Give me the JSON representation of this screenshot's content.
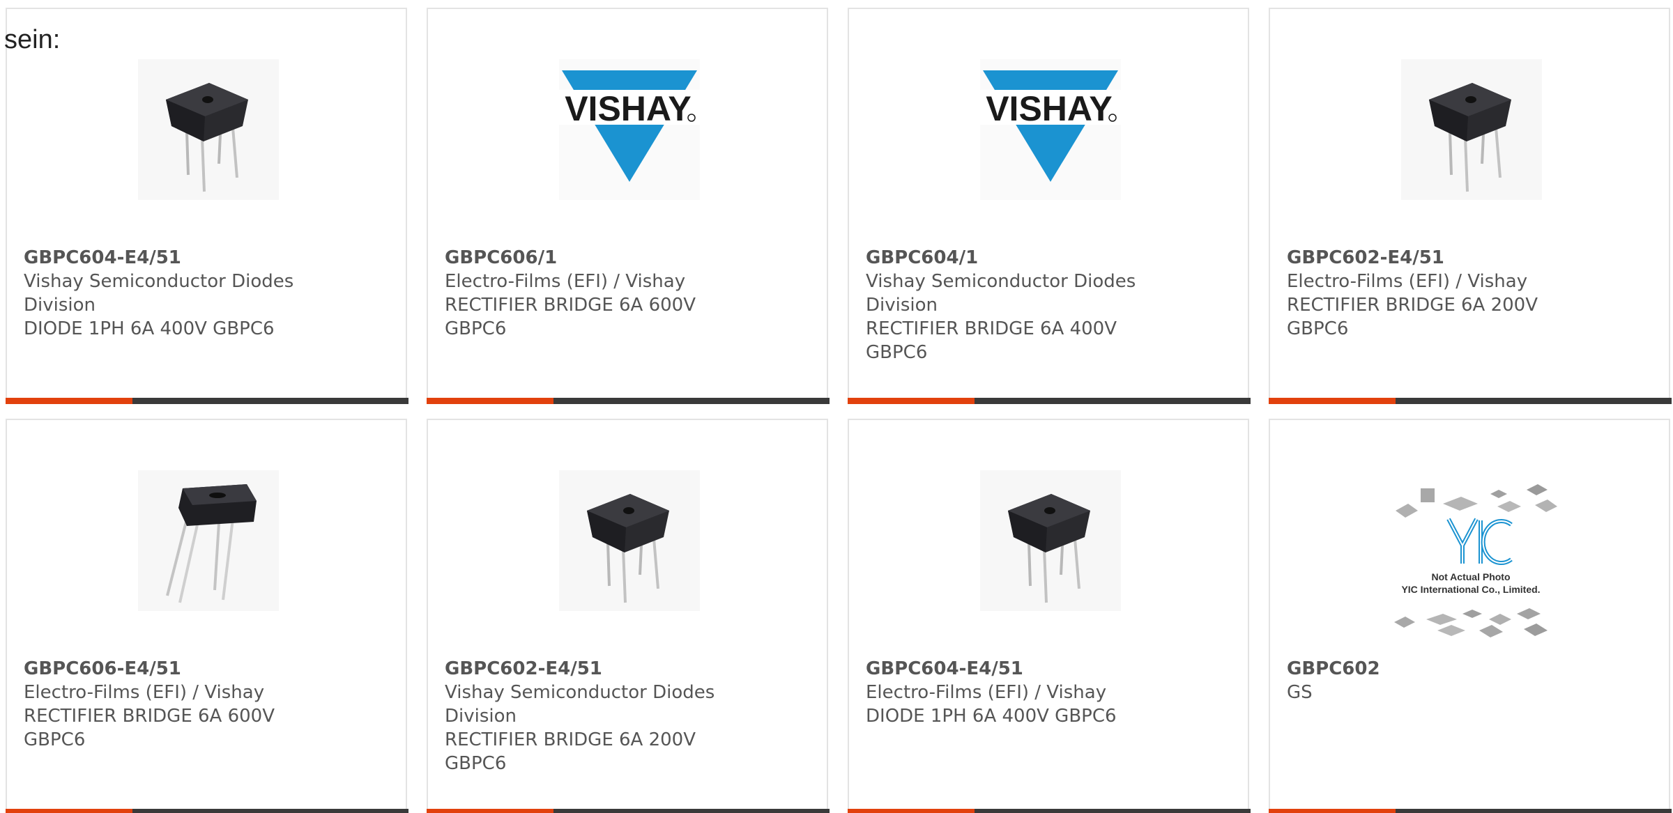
{
  "intro_text": "sein:",
  "colors": {
    "accent": "#e2410d",
    "bar": "#3a3a3a",
    "text": "#555555",
    "vishay_blue": "#1b93d1"
  },
  "cards": [
    {
      "part": "GBPC604-E4/51",
      "maker": "Vishay Semiconductor Diodes Division",
      "desc": "DIODE 1PH 6A 400V GBPC6",
      "image": "bridge-rectifier-photo"
    },
    {
      "part": "GBPC606/1",
      "maker": "Electro-Films (EFI) / Vishay",
      "desc": "RECTIFIER BRIDGE 6A 600V GBPC6",
      "image": "vishay-logo",
      "logo_text": "VISHAY"
    },
    {
      "part": "GBPC604/1",
      "maker": "Vishay Semiconductor Diodes Division",
      "desc": "RECTIFIER BRIDGE 6A 400V GBPC6",
      "image": "vishay-logo",
      "logo_text": "VISHAY"
    },
    {
      "part": "GBPC602-E4/51",
      "maker": "Electro-Films (EFI) / Vishay",
      "desc": "RECTIFIER BRIDGE 6A 200V GBPC6",
      "image": "bridge-rectifier-photo"
    },
    {
      "part": "GBPC606-E4/51",
      "maker": "Electro-Films (EFI) / Vishay",
      "desc": "RECTIFIER BRIDGE 6A 600V GBPC6",
      "image": "bridge-rectifier-photo-angled"
    },
    {
      "part": "GBPC602-E4/51",
      "maker": "Vishay Semiconductor Diodes Division",
      "desc": "RECTIFIER BRIDGE 6A 200V GBPC6",
      "image": "bridge-rectifier-photo"
    },
    {
      "part": "GBPC604-E4/51",
      "maker": "Electro-Films (EFI) / Vishay",
      "desc": "DIODE 1PH 6A 400V GBPC6",
      "image": "bridge-rectifier-photo"
    },
    {
      "part": "GBPC602",
      "maker": "GS",
      "desc": "",
      "image": "yic-placeholder",
      "placeholder_line1": "Not Actual Photo",
      "placeholder_line2": "YIC International Co., Limited."
    }
  ]
}
